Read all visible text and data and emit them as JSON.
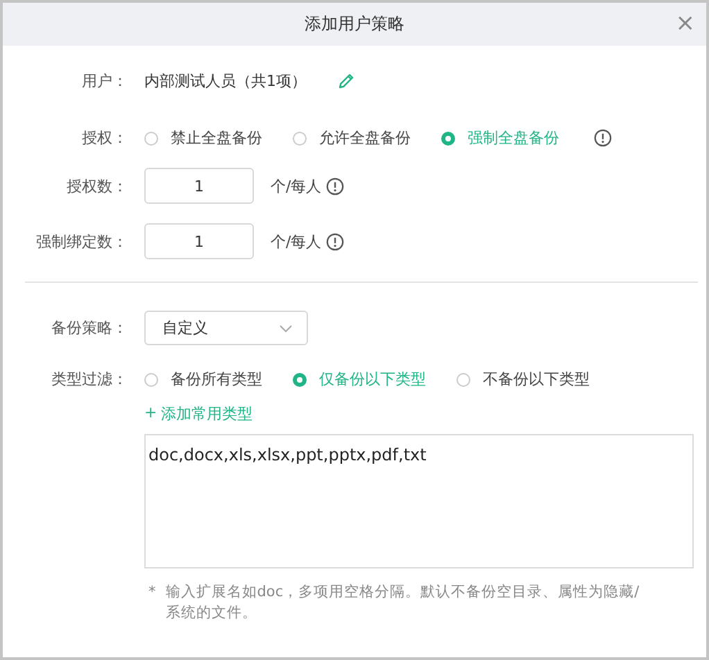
{
  "window": {
    "title": "添加用户策略",
    "close": "×"
  },
  "user": {
    "label": "用户：",
    "value": "内部测试人员（共1项）"
  },
  "auth": {
    "label": "授权：",
    "options": [
      {
        "label": "禁止全盘备份",
        "selected": false
      },
      {
        "label": "允许全盘备份",
        "selected": false
      },
      {
        "label": "强制全盘备份",
        "selected": true
      }
    ]
  },
  "count_fields": [
    {
      "label": "授权数：",
      "value": "1",
      "unit": "个/每人"
    },
    {
      "label": "强制绑定数：",
      "value": "1",
      "unit": "个/每人"
    }
  ],
  "strategy": {
    "label": "备份策略：",
    "value": "自定义"
  },
  "type_filter": {
    "label": "类型过滤：",
    "options": [
      {
        "label": "备份所有类型",
        "selected": false
      },
      {
        "label": "仅备份以下类型",
        "selected": true
      },
      {
        "label": "不备份以下类型",
        "selected": false
      }
    ]
  },
  "add_common_types": {
    "icon": "+",
    "label": "添加常用类型"
  },
  "extensions": "doc,docx,xls,xlsx,ppt,pptx,pdf,txt",
  "note": {
    "mark": "*",
    "text": "输入扩展名如doc，多项用空格分隔。默认不备份空目录、属性为隐藏/系统的文件。"
  }
}
